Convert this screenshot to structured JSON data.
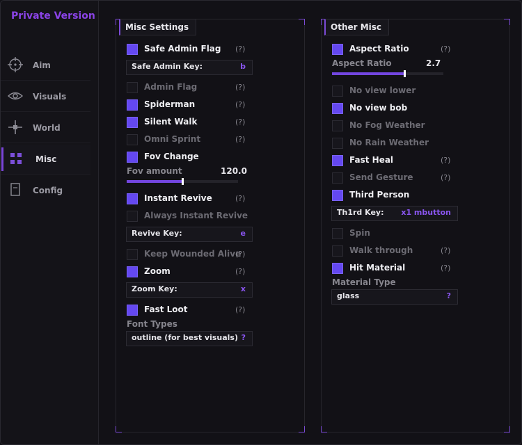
{
  "app": {
    "title": "Private Version"
  },
  "sidebar": {
    "items": [
      {
        "label": "Aim",
        "icon": "crosshair-icon"
      },
      {
        "label": "Visuals",
        "icon": "eye-icon"
      },
      {
        "label": "World",
        "icon": "world-icon"
      },
      {
        "label": "Misc",
        "icon": "grid-icon",
        "active": true
      },
      {
        "label": "Config",
        "icon": "document-icon"
      }
    ]
  },
  "misc": {
    "title": "Misc Settings",
    "safe_admin_flag": {
      "label": "Safe Admin Flag",
      "checked": true,
      "help": "(?)"
    },
    "safe_admin_key": {
      "label": "Safe Admin Key:",
      "value": "b"
    },
    "admin_flag": {
      "label": "Admin Flag",
      "checked": false,
      "help": "(?)"
    },
    "spiderman": {
      "label": "Spiderman",
      "checked": true,
      "help": "(?)"
    },
    "silent_walk": {
      "label": "Silent Walk",
      "checked": true,
      "help": "(?)"
    },
    "omni_sprint": {
      "label": "Omni Sprint",
      "checked": false,
      "help": "(?)"
    },
    "fov_change": {
      "label": "Fov Change",
      "checked": true
    },
    "fov_amount": {
      "label": "Fov amount",
      "value": "120.0",
      "fraction": 0.5
    },
    "instant_revive": {
      "label": "Instant Revive",
      "checked": true,
      "help": "(?)"
    },
    "always_instant_revive": {
      "label": "Always Instant Revive",
      "checked": false
    },
    "revive_key": {
      "label": "Revive Key:",
      "value": "e"
    },
    "keep_wounded_alive": {
      "label": "Keep Wounded Alive",
      "checked": false,
      "help": "(?)"
    },
    "zoom": {
      "label": "Zoom",
      "checked": true,
      "help": "(?)"
    },
    "zoom_key": {
      "label": "Zoom Key:",
      "value": "x"
    },
    "fast_loot": {
      "label": "Fast Loot",
      "checked": true,
      "help": "(?)"
    },
    "font_types": {
      "label": "Font Types",
      "value": "outline (for best visuals)",
      "button": "?"
    }
  },
  "other": {
    "title": "Other Misc",
    "aspect_ratio": {
      "label": "Aspect Ratio",
      "checked": true,
      "help": "(?)"
    },
    "aspect_ratio_slider": {
      "label": "Aspect Ratio",
      "value": "2.7",
      "fraction": 0.65
    },
    "no_view_lower": {
      "label": "No view lower",
      "checked": false
    },
    "no_view_bob": {
      "label": "No view bob",
      "checked": true
    },
    "no_fog_weather": {
      "label": "No Fog Weather",
      "checked": false
    },
    "no_rain_weather": {
      "label": "No Rain Weather",
      "checked": false
    },
    "fast_heal": {
      "label": "Fast Heal",
      "checked": true,
      "help": "(?)"
    },
    "send_gesture": {
      "label": "Send Gesture",
      "checked": false,
      "help": "(?)"
    },
    "third_person": {
      "label": "Third Person",
      "checked": true
    },
    "third_key": {
      "label": "Th1rd Key:",
      "value": "x1 mbutton"
    },
    "spin": {
      "label": "Spin",
      "checked": false
    },
    "walk_through": {
      "label": "Walk through",
      "checked": false,
      "help": "(?)"
    },
    "hit_material": {
      "label": "Hit Material",
      "checked": true,
      "help": "(?)"
    },
    "material_type": {
      "label": "Material Type",
      "value": "glass",
      "button": "?"
    }
  },
  "colors": {
    "accent": "#7c4bd6",
    "checkbox_on": "#6448f0",
    "brand": "#8a43e6"
  }
}
